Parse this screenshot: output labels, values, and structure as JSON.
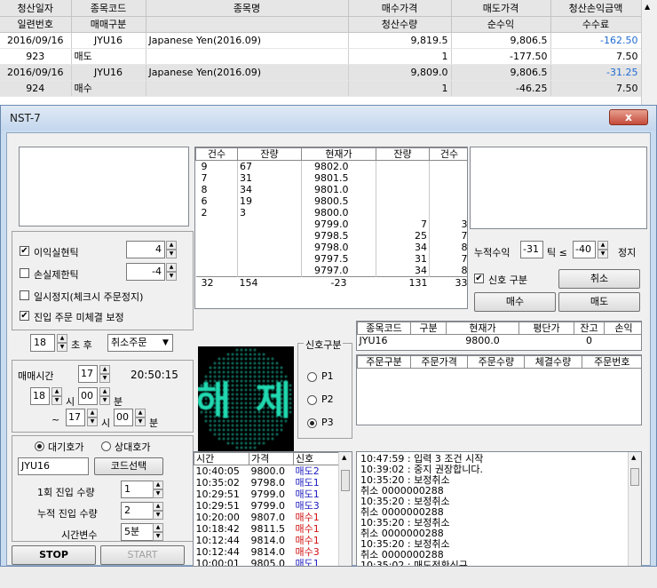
{
  "bg_table": {
    "headers1": [
      "청산일자",
      "종목코드",
      "종목명",
      "매수가격",
      "매도가격",
      "청산손익금액"
    ],
    "headers2": [
      "일련번호",
      "매매구분",
      "",
      "청산수량",
      "순수익",
      "수수료"
    ],
    "rows": [
      [
        "2016/09/16",
        "JYU16",
        "Japanese Yen(2016.09)",
        "9,819.5",
        "9,806.5",
        "-162.50"
      ],
      [
        "923",
        "매도",
        "",
        "1",
        "-177.50",
        "7.50"
      ],
      [
        "2016/09/16",
        "JYU16",
        "Japanese Yen(2016.09)",
        "9,809.0",
        "9,806.5",
        "-31.25"
      ],
      [
        "924",
        "매수",
        "",
        "1",
        "-46.25",
        "7.50"
      ]
    ]
  },
  "window": {
    "title": "NST-7",
    "close_label": "x"
  },
  "options": {
    "profit_track_label": "이익실현틱",
    "profit_track_checked": true,
    "profit_track_value": "4",
    "loss_track_label": "손실제한틱",
    "loss_track_checked": false,
    "loss_track_value": "-4",
    "pause_label": "일시정지(체크시 주문정지)",
    "pause_checked": false,
    "entry_fix_label": "진입 주문 미체결 보정",
    "entry_fix_checked": true,
    "entry_fix_seconds": "18",
    "after_label": "초 후",
    "entry_fix_action": "취소주문"
  },
  "trade_time": {
    "label": "매매시간",
    "hour": "17",
    "clock": "20:50:15",
    "start_h": "18",
    "start_m": "00",
    "end_h": "17",
    "end_m": "00",
    "h_label": "시",
    "m_label": "분",
    "tilde": "~"
  },
  "order_settings": {
    "radio1": "대기호가",
    "radio2": "상대호가",
    "radio1_selected": true,
    "code": "JYU16",
    "code_select_label": "코드선택",
    "entry_qty_label": "1회 진입 수량",
    "entry_qty": "1",
    "cum_qty_label": "누적 진입 수량",
    "cum_qty": "2",
    "time_var_label": "시간변수",
    "time_var": "5분"
  },
  "control_buttons": {
    "stop": "STOP",
    "start": "START"
  },
  "orderbook": {
    "headers": [
      "건수",
      "잔량",
      "현재가",
      "잔량",
      "건수"
    ],
    "rows": [
      [
        "9",
        "67",
        "9802.0",
        "",
        ""
      ],
      [
        "7",
        "31",
        "9801.5",
        "",
        ""
      ],
      [
        "8",
        "34",
        "9801.0",
        "",
        ""
      ],
      [
        "6",
        "19",
        "9800.5",
        "",
        ""
      ],
      [
        "2",
        "3",
        "9800.0",
        "",
        ""
      ],
      [
        "",
        "",
        "9799.0",
        "7",
        "3"
      ],
      [
        "",
        "",
        "9798.5",
        "25",
        "7"
      ],
      [
        "",
        "",
        "9798.0",
        "34",
        "8"
      ],
      [
        "",
        "",
        "9797.5",
        "31",
        "7"
      ],
      [
        "",
        "",
        "9797.0",
        "34",
        "8"
      ]
    ],
    "totals": [
      "32",
      "154",
      "-23",
      "131",
      "33"
    ]
  },
  "signal": {
    "group_label": "신호구분",
    "p1": "P1",
    "p2": "P2",
    "p3": "P3",
    "selected": "P3",
    "led_text": "해 제"
  },
  "right_controls": {
    "cum_profit_label": "누적수익",
    "cum_profit_value": "-31",
    "tick_label": "틱 ≤",
    "tick_value": "-40",
    "stop_label": "정지",
    "signal_split_label": "신호 구분",
    "signal_split_checked": true,
    "cancel_label": "취소",
    "buy_label": "매수",
    "sell_label": "매도"
  },
  "position": {
    "headers": [
      "종목코드",
      "구분",
      "현재가",
      "평단가",
      "잔고",
      "손익"
    ],
    "row": [
      "JYU16",
      "",
      "9800.0",
      "",
      "0",
      ""
    ]
  },
  "orders": {
    "headers": [
      "주문구분",
      "주문가격",
      "주문수량",
      "체결수량",
      "주문번호"
    ]
  },
  "signals": {
    "headers": [
      "시간",
      "가격",
      "신호"
    ],
    "rows": [
      [
        "10:40:05",
        "9800.0",
        "매도2"
      ],
      [
        "10:35:02",
        "9798.0",
        "매도1"
      ],
      [
        "10:29:51",
        "9799.0",
        "매도1"
      ],
      [
        "10:29:51",
        "9799.0",
        "매도3"
      ],
      [
        "10:20:00",
        "9807.0",
        "매수1"
      ],
      [
        "10:18:42",
        "9811.5",
        "매수1"
      ],
      [
        "10:12:44",
        "9814.0",
        "매수1"
      ],
      [
        "10:12:44",
        "9814.0",
        "매수3"
      ],
      [
        "10:00:01",
        "9805.0",
        "매도1"
      ]
    ]
  },
  "log": [
    "10:47:59 : 입력 3 조건 시작",
    "10:39:02 : 중지 권장합니다.",
    "10:35:20 : 보정취소",
    "취소 0000000288",
    "10:35:20 : 보정취소",
    "취소 0000000288",
    "10:35:20 : 보정취소",
    "취소 0000000288",
    "10:35:20 : 보정취소",
    "취소 0000000288",
    "10:35:02 : 매도전환신규"
  ],
  "colors": {
    "buy": "#d01010",
    "sell": "#2020c0",
    "loss": "#1e6ad2",
    "led": "#20d8b0"
  }
}
